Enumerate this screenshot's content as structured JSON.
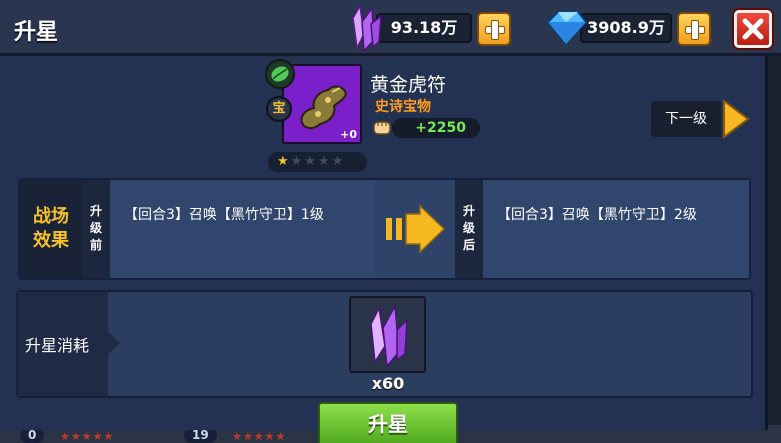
{
  "header": {
    "title": "升星",
    "crystal_amount": "93.18万",
    "gem_amount": "3908.9万"
  },
  "item": {
    "name": "黄金虎符",
    "rarity": "史诗宝物",
    "level_badge": "+0",
    "type_badge": "宝",
    "power": "+2250",
    "stars_filled": 1,
    "stars_total": 5,
    "next_level_label": "下一级"
  },
  "effect": {
    "section_label": "战场效果",
    "before_tab": "升级前",
    "after_tab": "升级后",
    "before_text": "【回合3】召唤【黑竹守卫】1级",
    "after_text": "【回合3】召唤【黑竹守卫】2级"
  },
  "cost": {
    "label": "升星消耗",
    "quantity": "x60"
  },
  "actions": {
    "upgrade_label": "升星"
  },
  "background_peek": {
    "chip_left": "0",
    "chip_right": "19"
  },
  "colors": {
    "accent_gold": "#f5c028",
    "rarity_orange": "#ff9d1f",
    "power_green": "#78e85a",
    "item_purple": "#7a1fc9",
    "button_green": "#6cc534",
    "close_red": "#d8372a"
  }
}
